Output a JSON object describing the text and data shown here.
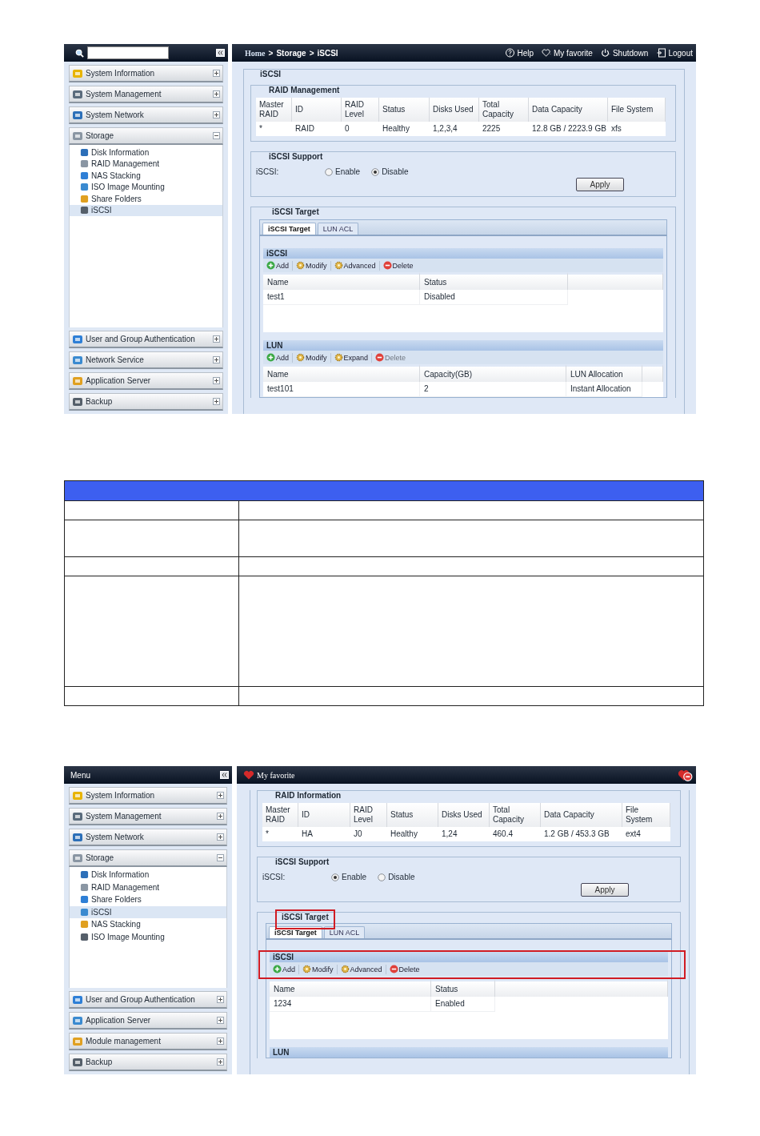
{
  "screenshots": [
    {
      "sidebar": {
        "header": {
          "kind": "search"
        },
        "items": [
          {
            "label": "System Information",
            "expanded": false
          },
          {
            "label": "System Management",
            "expanded": false
          },
          {
            "label": "System Network",
            "expanded": false
          },
          {
            "label": "Storage",
            "expanded": true,
            "children": [
              {
                "label": "Disk Information",
                "selected": false
              },
              {
                "label": "RAID Management",
                "selected": false
              },
              {
                "label": "NAS Stacking",
                "selected": false
              },
              {
                "label": "ISO Image Mounting",
                "selected": false
              },
              {
                "label": "Share Folders",
                "selected": false
              },
              {
                "label": "iSCSI",
                "selected": true
              }
            ]
          },
          {
            "label": "User and Group Authentication",
            "expanded": false
          },
          {
            "label": "Network Service",
            "expanded": false
          },
          {
            "label": "Application Server",
            "expanded": false
          },
          {
            "label": "Backup",
            "expanded": false
          }
        ]
      },
      "topbar": {
        "kind": "breadcrumb",
        "crumbs": [
          "Home",
          "Storage",
          "iSCSI"
        ],
        "separator": ">",
        "links": [
          {
            "label": "Help",
            "kind": "help"
          },
          {
            "label": "My favorite",
            "kind": "favorite"
          },
          {
            "label": "Shutdown",
            "kind": "shutdown"
          },
          {
            "label": "Logout",
            "kind": "logout"
          }
        ]
      },
      "content": {
        "legend": "iSCSI",
        "raid": {
          "legend": "RAID Management",
          "columns": [
            "Master RAID",
            "ID",
            "RAID Level",
            "Status",
            "Disks Used",
            "Total Capacity",
            "Data Capacity",
            "File System"
          ],
          "rows": [
            [
              "*",
              "RAID",
              "0",
              "Healthy",
              "1,2,3,4",
              "2225",
              "12.8 GB / 2223.9 GB",
              "xfs"
            ]
          ]
        },
        "support": {
          "legend": "iSCSI Support",
          "label": "iSCSI:",
          "options": [
            {
              "label": "Enable",
              "selected": false
            },
            {
              "label": "Disable",
              "selected": true
            }
          ],
          "apply": "Apply"
        },
        "target": {
          "legend": "iSCSI Target",
          "highlighted": false,
          "tabs": [
            {
              "label": "iSCSI Target",
              "selected": true
            },
            {
              "label": "LUN ACL",
              "selected": false
            }
          ],
          "panels": [
            {
              "title": "iSCSI",
              "highlighted": false,
              "toolbar": [
                {
                  "label": "Add",
                  "kind": "add",
                  "disabled": false
                },
                {
                  "label": "Modify",
                  "kind": "modify",
                  "disabled": false
                },
                {
                  "label": "Advanced",
                  "kind": "advanced",
                  "disabled": false
                },
                {
                  "label": "Delete",
                  "kind": "delete",
                  "disabled": false
                }
              ],
              "columns": [
                "Name",
                "Status"
              ],
              "rows": [
                [
                  "test1",
                  "Disabled"
                ]
              ]
            },
            {
              "title": "LUN",
              "highlighted": false,
              "toolbar": [
                {
                  "label": "Add",
                  "kind": "add",
                  "disabled": false
                },
                {
                  "label": "Modify",
                  "kind": "modify",
                  "disabled": false
                },
                {
                  "label": "Expand",
                  "kind": "expand",
                  "disabled": false
                },
                {
                  "label": "Delete",
                  "kind": "delete",
                  "disabled": true
                }
              ],
              "columns": [
                "Name",
                "Capacity(GB)",
                "LUN Allocation"
              ],
              "rows": [
                [
                  "test101",
                  "2",
                  "Instant Allocation"
                ]
              ]
            }
          ]
        }
      }
    },
    {
      "sidebar": {
        "header": {
          "kind": "title",
          "title": "Menu"
        },
        "items": [
          {
            "label": "System Information",
            "expanded": false
          },
          {
            "label": "System Management",
            "expanded": false
          },
          {
            "label": "System Network",
            "expanded": false
          },
          {
            "label": "Storage",
            "expanded": true,
            "children": [
              {
                "label": "Disk Information",
                "selected": false
              },
              {
                "label": "RAID Management",
                "selected": false
              },
              {
                "label": "Share Folders",
                "selected": false
              },
              {
                "label": "iSCSI",
                "selected": true
              },
              {
                "label": "NAS Stacking",
                "selected": false
              },
              {
                "label": "ISO Image Mounting",
                "selected": false
              }
            ]
          },
          {
            "label": "User and Group Authentication",
            "expanded": false
          },
          {
            "label": "Application Server",
            "expanded": false
          },
          {
            "label": "Module management",
            "expanded": false
          },
          {
            "label": "Backup",
            "expanded": false
          }
        ]
      },
      "topbar": {
        "kind": "title",
        "title": "My favorite"
      },
      "content": {
        "raid": {
          "legend": "RAID Information",
          "columns": [
            "Master RAID",
            "ID",
            "RAID Level",
            "Status",
            "Disks Used",
            "Total Capacity",
            "Data Capacity",
            "File System"
          ],
          "rows": [
            [
              "*",
              "HA",
              "J0",
              "Healthy",
              "1,24",
              "460.4",
              "1.2 GB / 453.3 GB",
              "ext4"
            ]
          ]
        },
        "support": {
          "legend": "iSCSI Support",
          "label": "iSCSI:",
          "options": [
            {
              "label": "Enable",
              "selected": true
            },
            {
              "label": "Disable",
              "selected": false
            }
          ],
          "apply": "Apply"
        },
        "target": {
          "legend": "iSCSI Target",
          "highlighted": true,
          "tabs": [
            {
              "label": "iSCSI Target",
              "selected": true
            },
            {
              "label": "LUN ACL",
              "selected": false
            }
          ],
          "panels": [
            {
              "title": "iSCSI",
              "highlighted": true,
              "toolbar": [
                {
                  "label": "Add",
                  "kind": "add",
                  "disabled": false
                },
                {
                  "label": "Modify",
                  "kind": "modify",
                  "disabled": false
                },
                {
                  "label": "Advanced",
                  "kind": "advanced",
                  "disabled": false
                },
                {
                  "label": "Delete",
                  "kind": "delete",
                  "disabled": false
                }
              ],
              "columns": [
                "Name",
                "Status"
              ],
              "rows": [
                [
                  "1234",
                  "Enabled"
                ]
              ]
            },
            {
              "title": "LUN",
              "highlighted": false
            }
          ]
        }
      }
    }
  ]
}
